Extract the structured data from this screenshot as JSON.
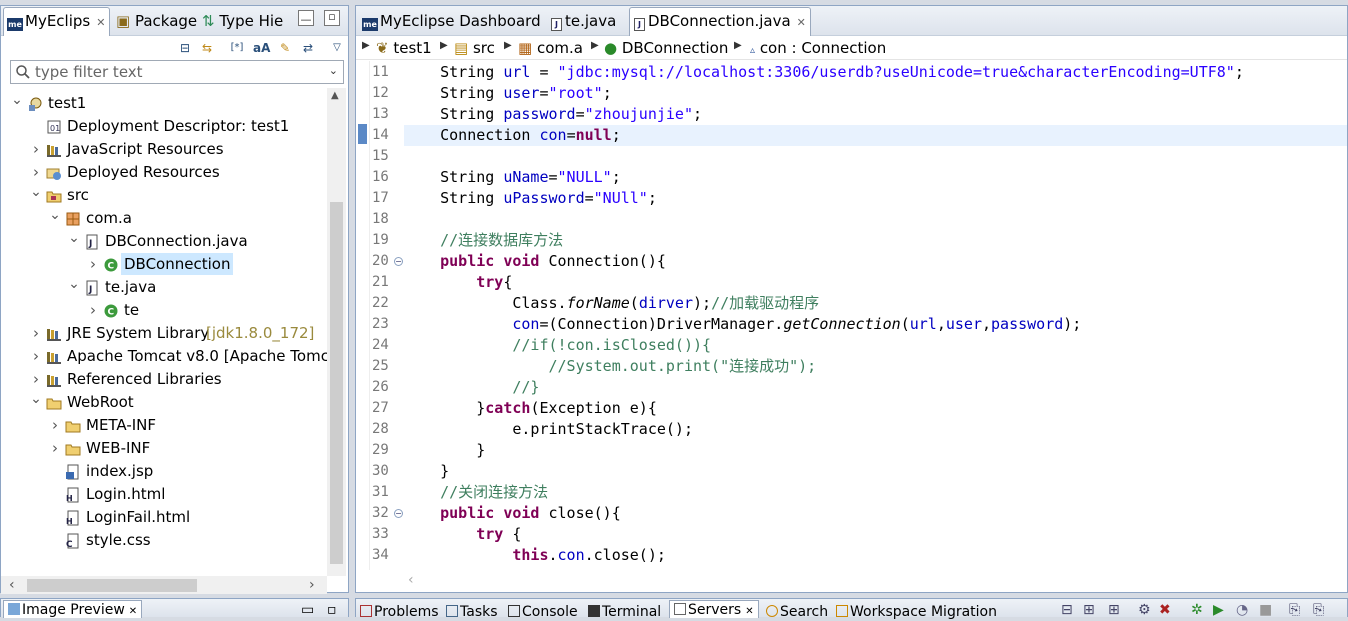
{
  "left_panel": {
    "tabs": [
      {
        "label": "MyEclips"
      },
      {
        "label": "Package"
      },
      {
        "label": "Type Hie"
      }
    ],
    "filter_placeholder": "type filter text",
    "tree": [
      {
        "label": "test1",
        "level": 0,
        "twisty": "down",
        "icon": "project-icon"
      },
      {
        "label": "Deployment Descriptor: test1",
        "level": 1,
        "twisty": "none",
        "icon": "deployment-descriptor-icon"
      },
      {
        "label": "JavaScript Resources",
        "level": 1,
        "twisty": "right",
        "icon": "library-icon"
      },
      {
        "label": "Deployed Resources",
        "level": 1,
        "twisty": "right",
        "icon": "deployed-resources-icon"
      },
      {
        "label": "src",
        "level": 1,
        "twisty": "down",
        "icon": "source-folder-icon"
      },
      {
        "label": "com.a",
        "level": 2,
        "twisty": "down",
        "icon": "package-icon"
      },
      {
        "label": "DBConnection.java",
        "level": 3,
        "twisty": "down",
        "icon": "java-file-icon"
      },
      {
        "label": "DBConnection",
        "level": 4,
        "twisty": "right",
        "icon": "class-icon",
        "selected": true
      },
      {
        "label": "te.java",
        "level": 3,
        "twisty": "down",
        "icon": "java-file-icon"
      },
      {
        "label": "te",
        "level": 4,
        "twisty": "right",
        "icon": "class-icon"
      },
      {
        "label": "JRE System Library",
        "decor": "[jdk1.8.0_172]",
        "level": 1,
        "twisty": "right",
        "icon": "library-icon"
      },
      {
        "label": "Apache Tomcat v8.0 [Apache Tomc",
        "level": 1,
        "twisty": "right",
        "icon": "library-icon"
      },
      {
        "label": "Referenced Libraries",
        "level": 1,
        "twisty": "right",
        "icon": "library-icon"
      },
      {
        "label": "WebRoot",
        "level": 1,
        "twisty": "down",
        "icon": "folder-icon"
      },
      {
        "label": "META-INF",
        "level": 2,
        "twisty": "right",
        "icon": "folder-icon"
      },
      {
        "label": "WEB-INF",
        "level": 2,
        "twisty": "right",
        "icon": "folder-icon"
      },
      {
        "label": "index.jsp",
        "level": 2,
        "twisty": "none",
        "icon": "jsp-file-icon"
      },
      {
        "label": "Login.html",
        "level": 2,
        "twisty": "none",
        "icon": "html-file-icon"
      },
      {
        "label": "LoginFail.html",
        "level": 2,
        "twisty": "none",
        "icon": "html-file-icon"
      },
      {
        "label": "style.css",
        "level": 2,
        "twisty": "none",
        "icon": "css-file-icon"
      }
    ]
  },
  "editor": {
    "tabs": [
      {
        "label": "MyEclipse Dashboard"
      },
      {
        "label": "te.java"
      },
      {
        "label": "DBConnection.java"
      }
    ],
    "breadcrumb": [
      "test1",
      "src",
      "com.a",
      "DBConnection",
      "con : Connection"
    ],
    "current_line": 14,
    "lines": [
      {
        "n": "11",
        "tokens": [
          [
            "",
            "    String "
          ],
          [
            "fld",
            "url"
          ],
          [
            "",
            " = "
          ],
          [
            "str",
            "\"jdbc:mysql://localhost:3306/userdb?useUnicode=true&characterEncoding=UTF8\""
          ],
          [
            "",
            ";"
          ]
        ]
      },
      {
        "n": "12",
        "tokens": [
          [
            "",
            "    String "
          ],
          [
            "fld",
            "user"
          ],
          [
            "",
            "="
          ],
          [
            "str",
            "\"root\""
          ],
          [
            "",
            ";"
          ]
        ]
      },
      {
        "n": "13",
        "tokens": [
          [
            "",
            "    String "
          ],
          [
            "fld",
            "password"
          ],
          [
            "",
            "="
          ],
          [
            "str",
            "\"zhoujunjie\""
          ],
          [
            "",
            ";"
          ]
        ]
      },
      {
        "n": "14",
        "tokens": [
          [
            "",
            "    Connection "
          ],
          [
            "fld",
            "con"
          ],
          [
            "",
            "="
          ],
          [
            "kw",
            "null"
          ],
          [
            "",
            ";"
          ]
        ]
      },
      {
        "n": "15",
        "tokens": []
      },
      {
        "n": "16",
        "tokens": [
          [
            "",
            "    String "
          ],
          [
            "fld",
            "uName"
          ],
          [
            "",
            "="
          ],
          [
            "str",
            "\"NULL\""
          ],
          [
            "",
            ";"
          ]
        ]
      },
      {
        "n": "17",
        "tokens": [
          [
            "",
            "    String "
          ],
          [
            "fld",
            "uPassword"
          ],
          [
            "",
            "="
          ],
          [
            "str",
            "\"NUll\""
          ],
          [
            "",
            ";"
          ]
        ]
      },
      {
        "n": "18",
        "tokens": []
      },
      {
        "n": "19",
        "tokens": [
          [
            "",
            "    "
          ],
          [
            "cm",
            "//连接数据库方法"
          ]
        ]
      },
      {
        "n": "20",
        "fold": true,
        "tokens": [
          [
            "",
            "    "
          ],
          [
            "kw",
            "public"
          ],
          [
            "",
            " "
          ],
          [
            "kw",
            "void"
          ],
          [
            "",
            " Connection(){"
          ]
        ]
      },
      {
        "n": "21",
        "tokens": [
          [
            "",
            "        "
          ],
          [
            "kw",
            "try"
          ],
          [
            "",
            "{"
          ]
        ]
      },
      {
        "n": "22",
        "tokens": [
          [
            "",
            "            Class."
          ],
          [
            "it",
            "forName"
          ],
          [
            "",
            "("
          ],
          [
            "fld",
            "dirver"
          ],
          [
            "",
            ");"
          ],
          [
            "cm",
            "//加载驱动程序"
          ]
        ]
      },
      {
        "n": "23",
        "tokens": [
          [
            "",
            "            "
          ],
          [
            "fld",
            "con"
          ],
          [
            "",
            "=(Connection)DriverManager."
          ],
          [
            "it",
            "getConnection"
          ],
          [
            "",
            "("
          ],
          [
            "fld",
            "url"
          ],
          [
            "",
            ","
          ],
          [
            "fld",
            "user"
          ],
          [
            "",
            ","
          ],
          [
            "fld",
            "password"
          ],
          [
            "",
            ");"
          ]
        ]
      },
      {
        "n": "24",
        "tokens": [
          [
            "",
            "            "
          ],
          [
            "cm",
            "//if(!con.isClosed()){"
          ]
        ]
      },
      {
        "n": "25",
        "tokens": [
          [
            "",
            "                "
          ],
          [
            "cm",
            "//System.out.print(\"连接成功\");"
          ]
        ]
      },
      {
        "n": "26",
        "tokens": [
          [
            "",
            "            "
          ],
          [
            "cm",
            "//}"
          ]
        ]
      },
      {
        "n": "27",
        "tokens": [
          [
            "",
            "        }"
          ],
          [
            "kw",
            "catch"
          ],
          [
            "",
            "(Exception e){"
          ]
        ]
      },
      {
        "n": "28",
        "tokens": [
          [
            "",
            "            e.printStackTrace();"
          ]
        ]
      },
      {
        "n": "29",
        "tokens": [
          [
            "",
            "        }"
          ]
        ]
      },
      {
        "n": "30",
        "tokens": [
          [
            "",
            "    }"
          ]
        ]
      },
      {
        "n": "31",
        "tokens": [
          [
            "",
            "    "
          ],
          [
            "cm",
            "//关闭连接方法"
          ]
        ]
      },
      {
        "n": "32",
        "fold": true,
        "tokens": [
          [
            "",
            "    "
          ],
          [
            "kw",
            "public"
          ],
          [
            "",
            " "
          ],
          [
            "kw",
            "void"
          ],
          [
            "",
            " close(){"
          ]
        ]
      },
      {
        "n": "33",
        "tokens": [
          [
            "",
            "        "
          ],
          [
            "kw",
            "try"
          ],
          [
            "",
            " {"
          ]
        ]
      },
      {
        "n": "34",
        "tokens": [
          [
            "",
            "            "
          ],
          [
            "kw",
            "this"
          ],
          [
            "",
            "."
          ],
          [
            "fld",
            "con"
          ],
          [
            "",
            ".close();"
          ]
        ]
      }
    ]
  },
  "bottom_left": {
    "tabs": [
      {
        "label": "Image Preview"
      }
    ]
  },
  "bottom_right": {
    "tabs": [
      {
        "label": "Problems"
      },
      {
        "label": "Tasks"
      },
      {
        "label": "Console"
      },
      {
        "label": "Terminal"
      },
      {
        "label": "Servers"
      },
      {
        "label": "Search"
      },
      {
        "label": "Workspace Migration"
      }
    ]
  }
}
